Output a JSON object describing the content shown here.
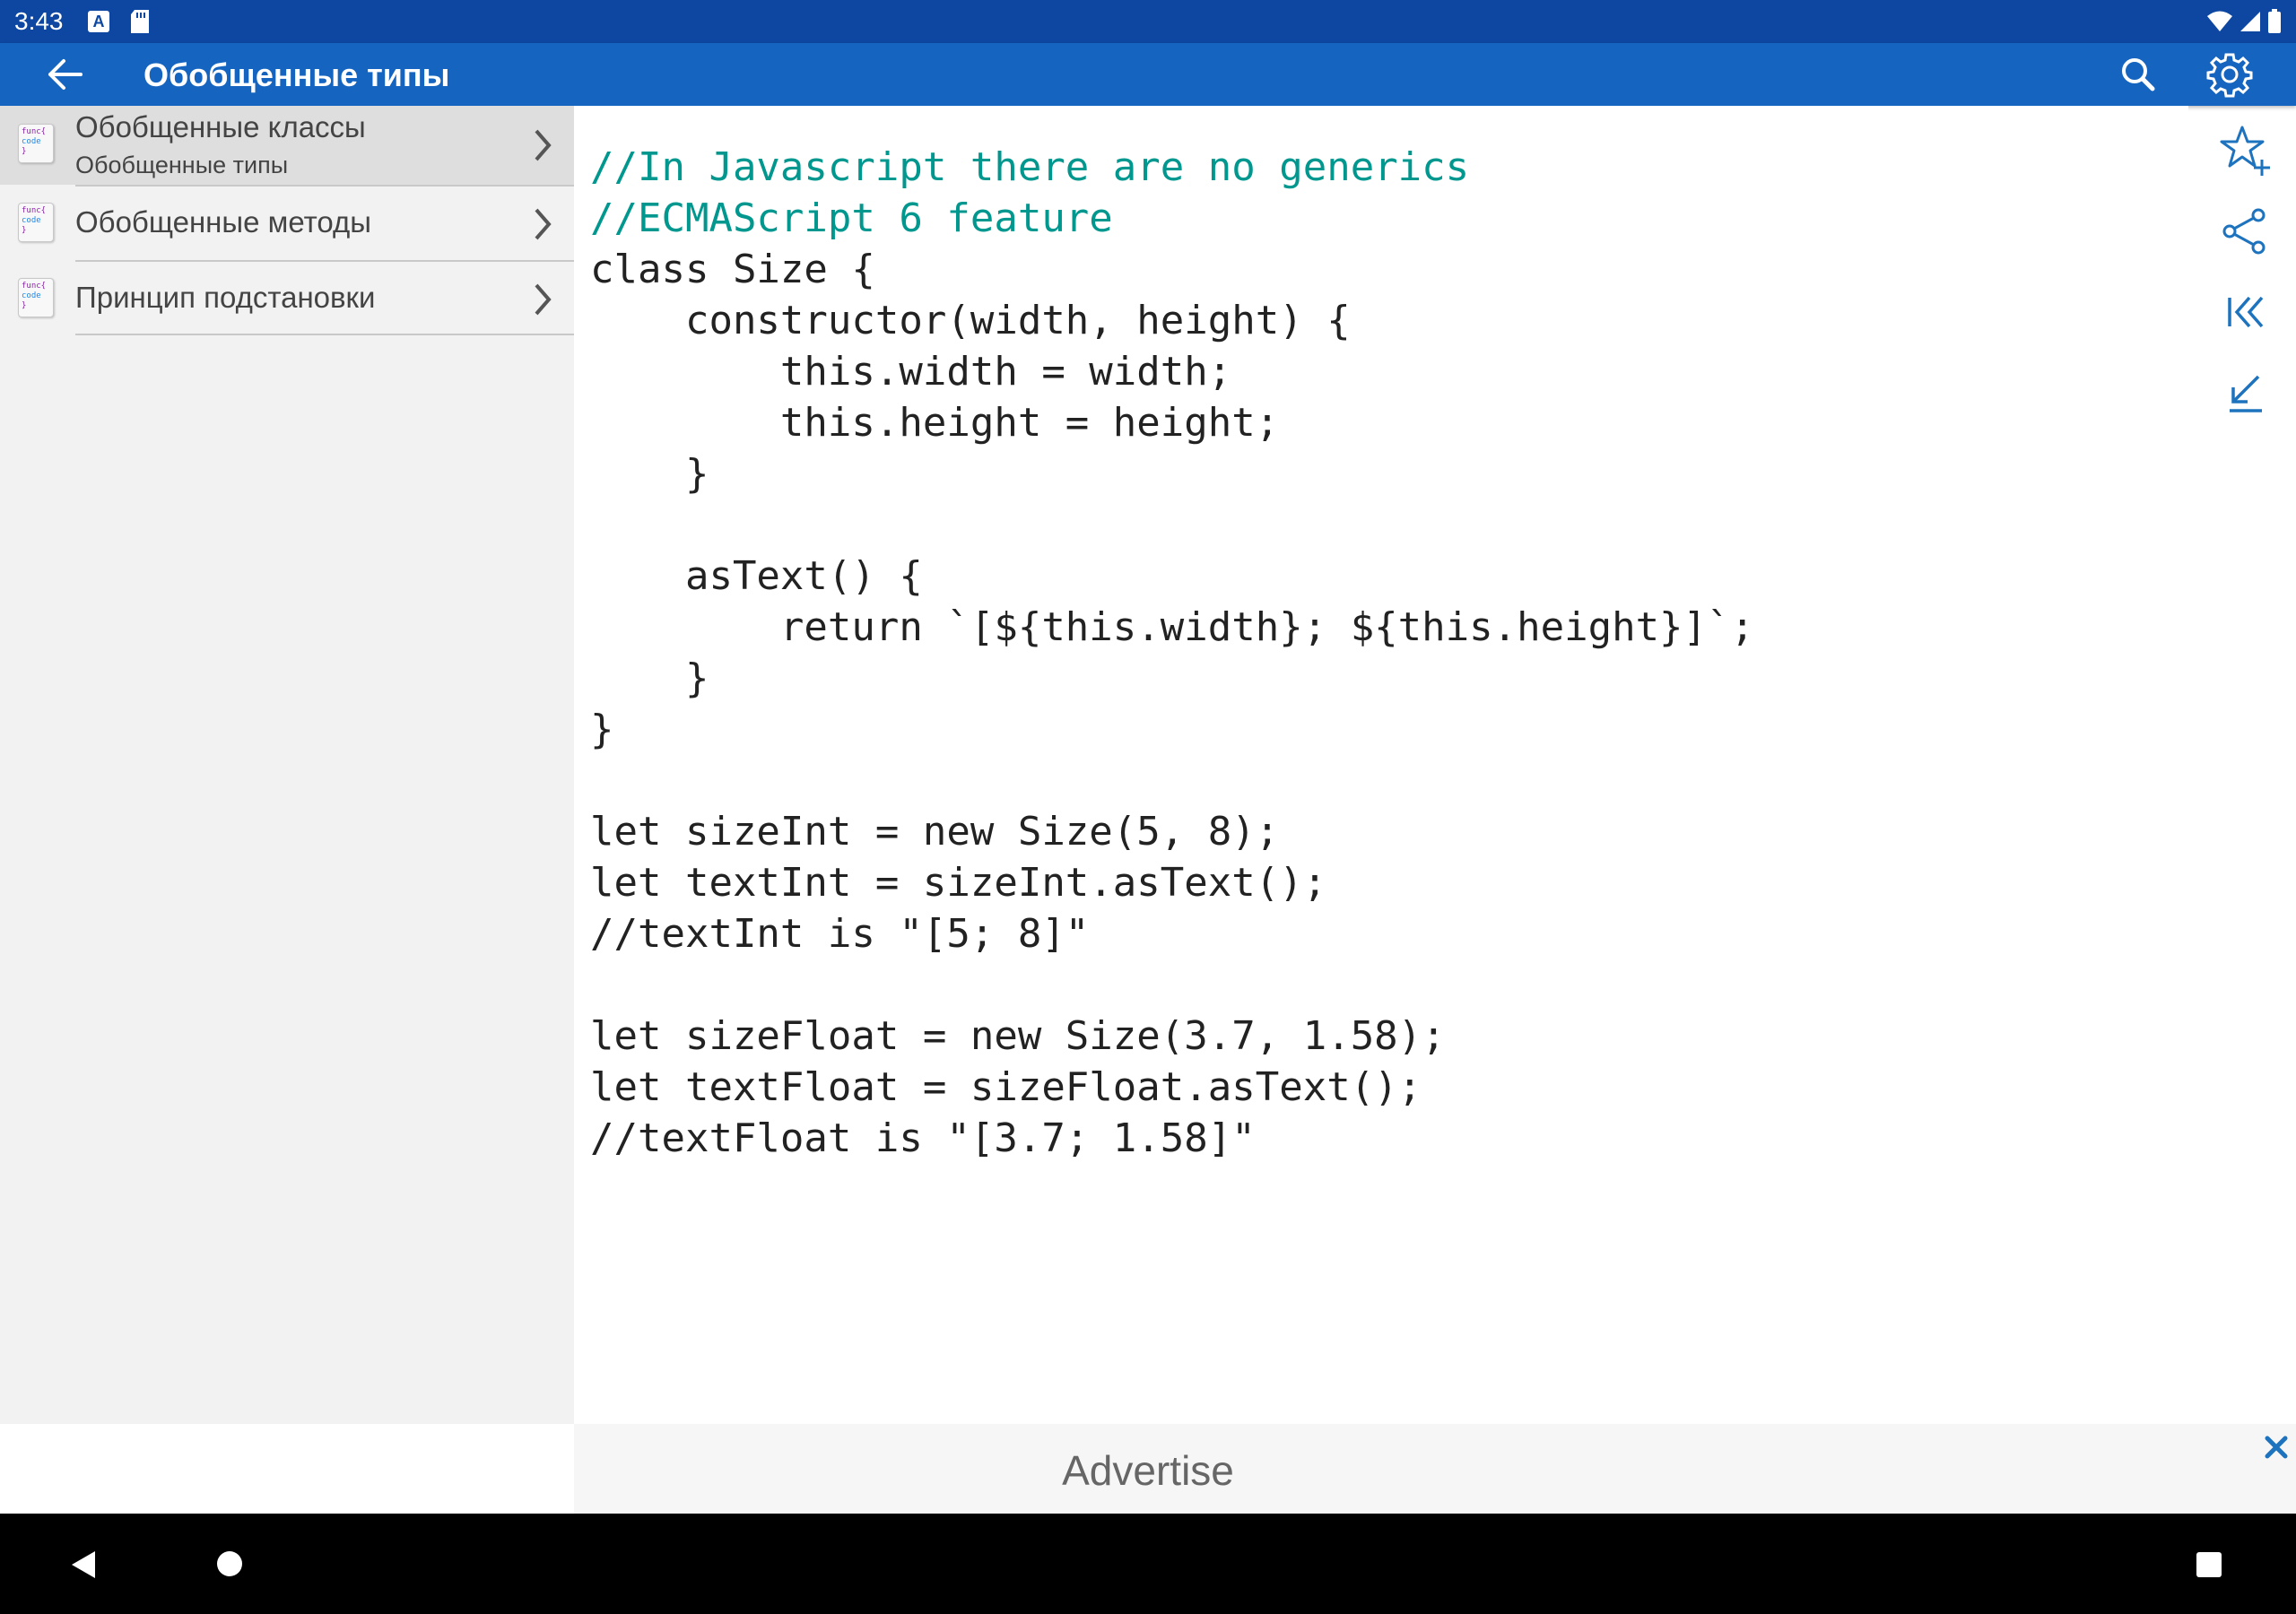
{
  "status_bar": {
    "time": "3:43",
    "notification_icons": [
      "a-icon",
      "sd-card-icon"
    ],
    "system_icons": [
      "wifi-icon",
      "signal-icon",
      "battery-icon"
    ]
  },
  "app_bar": {
    "title": "Обобщенные типы",
    "actions": [
      "search-icon",
      "settings-icon"
    ]
  },
  "sidebar": {
    "items": [
      {
        "label": "Обобщенные классы",
        "sublabel": "Обобщенные типы",
        "selected": true
      },
      {
        "label": "Обобщенные методы",
        "selected": false
      },
      {
        "label": "Принцип подстановки",
        "selected": false
      }
    ],
    "icon_text": [
      "func{",
      "code",
      "}"
    ]
  },
  "code": {
    "lines": [
      "//In Javascript there are no generics",
      "//ECMAScript 6 feature",
      "class Size {",
      "    constructor(width, height) {",
      "        this.width = width;",
      "        this.height = height;",
      "    }",
      "",
      "    asText() {",
      "        return `[${this.width}; ${this.height}]`;",
      "    }",
      "}",
      "",
      "let sizeInt = new Size(5, 8);",
      "let textInt = sizeInt.asText();",
      "//textInt is \"[5; 8]\"",
      "",
      "let sizeFloat = new Size(3.7, 1.58);",
      "let textFloat = sizeFloat.asText();",
      "//textFloat is \"[3.7; 1.58]\""
    ],
    "colors": {
      "keyword": "#00978f",
      "literal": "#e07b00",
      "plain": "#222222"
    }
  },
  "tools": [
    "add-favorite-icon",
    "share-icon",
    "first-page-icon",
    "last-page-icon"
  ],
  "ad": {
    "text": "Advertise"
  },
  "colors": {
    "status_bar": "#0d47a1",
    "app_bar": "#1565c0",
    "accent": "#1e73be"
  }
}
